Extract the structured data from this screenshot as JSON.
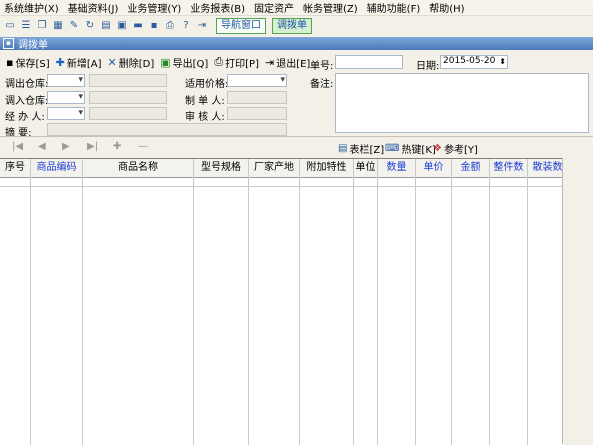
{
  "menu": [
    "系统维护(X)",
    "基础资料(J)",
    "业务管理(Y)",
    "业务报表(B)",
    "固定资产",
    "帐务管理(Z)",
    "辅助功能(F)",
    "帮助(H)"
  ],
  "quick_icons": [
    "new-doc-icon",
    "list-icon",
    "copy-icon",
    "grid-icon",
    "tool-icon",
    "refresh-icon",
    "stack-icon",
    "box-icon",
    "display-icon",
    "save-icon",
    "print-icon",
    "help-icon",
    "export-icon"
  ],
  "nav_buttons": {
    "nav_window": "导航窗口",
    "transfer": "调拨单"
  },
  "doc_title": "调拨单",
  "toolbar": {
    "save": "保存[S]",
    "add": "新增[A]",
    "delete": "删除[D]",
    "export": "导出[Q]",
    "print": "打印[P]",
    "exit": "退出[E]",
    "doc_no_label": "单号:",
    "date_label": "日期:",
    "date_value": "2015-05-20"
  },
  "form": {
    "out_warehouse": "调出仓库:",
    "in_warehouse": "调入仓库:",
    "handler": "经 办 人:",
    "summary": "摘    要:",
    "price_label": "适用价格:",
    "maker": "制 单 人:",
    "reviewer": "审 核 人:",
    "remarks": "备注:"
  },
  "grid_tools": {
    "columns": "表栏[Z]",
    "hotkey": "热键[K]",
    "reference": "参考[Y]"
  },
  "nav_arrows": [
    "|◀",
    "◀",
    "▶",
    "▶|",
    "✚",
    "—"
  ],
  "columns": [
    {
      "label": "序号",
      "color": "#000000"
    },
    {
      "label": "商品编码",
      "color": "#1a3fd6"
    },
    {
      "label": "商品名称",
      "color": "#000000"
    },
    {
      "label": "型号规格",
      "color": "#000000"
    },
    {
      "label": "厂家产地",
      "color": "#000000"
    },
    {
      "label": "附加特性",
      "color": "#000000"
    },
    {
      "label": "单位",
      "color": "#000000"
    },
    {
      "label": "数量",
      "color": "#1a3fd6"
    },
    {
      "label": "单价",
      "color": "#1a3fd6"
    },
    {
      "label": "金额",
      "color": "#1a3fd6"
    },
    {
      "label": "整件数",
      "color": "#1a3fd6"
    },
    {
      "label": "散装数",
      "color": "#1a3fd6"
    }
  ]
}
